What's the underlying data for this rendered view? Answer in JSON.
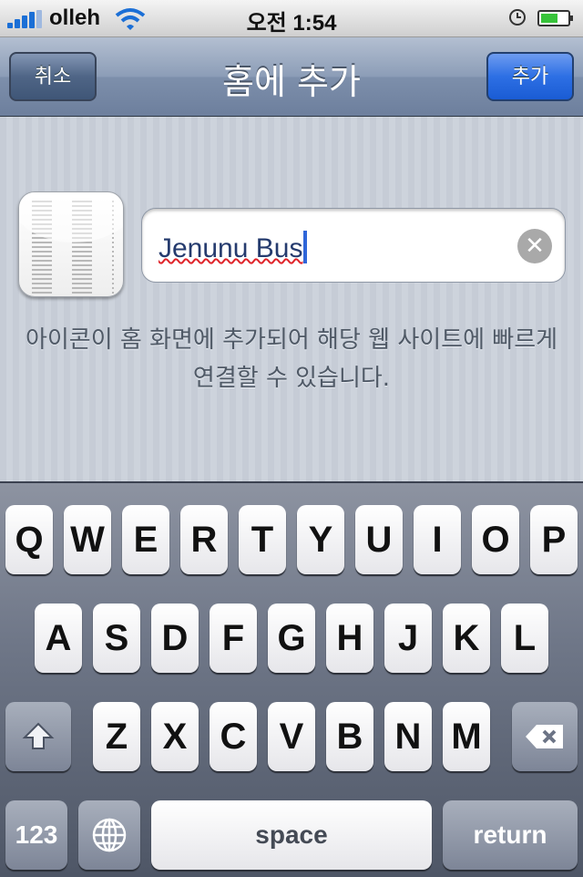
{
  "status_bar": {
    "carrier": "olleh",
    "time": "오전 1:54"
  },
  "nav": {
    "title": "홈에 추가",
    "cancel_label": "취소",
    "add_label": "추가"
  },
  "form": {
    "name_value": "Jenunu Bus",
    "hint": "아이콘이 홈 화면에 추가되어 해당 웹 사이트에 빠르게 연결할 수 있습니다."
  },
  "keyboard": {
    "row1": [
      "Q",
      "W",
      "E",
      "R",
      "T",
      "Y",
      "U",
      "I",
      "O",
      "P"
    ],
    "row2": [
      "A",
      "S",
      "D",
      "F",
      "G",
      "H",
      "J",
      "K",
      "L"
    ],
    "row3": [
      "Z",
      "X",
      "C",
      "V",
      "B",
      "N",
      "M"
    ],
    "numbers_label": "123",
    "space_label": "space",
    "return_label": "return"
  },
  "colors": {
    "accent": "#2d6fe4",
    "signal": "#1b6fd6",
    "battery": "#37c33a"
  }
}
